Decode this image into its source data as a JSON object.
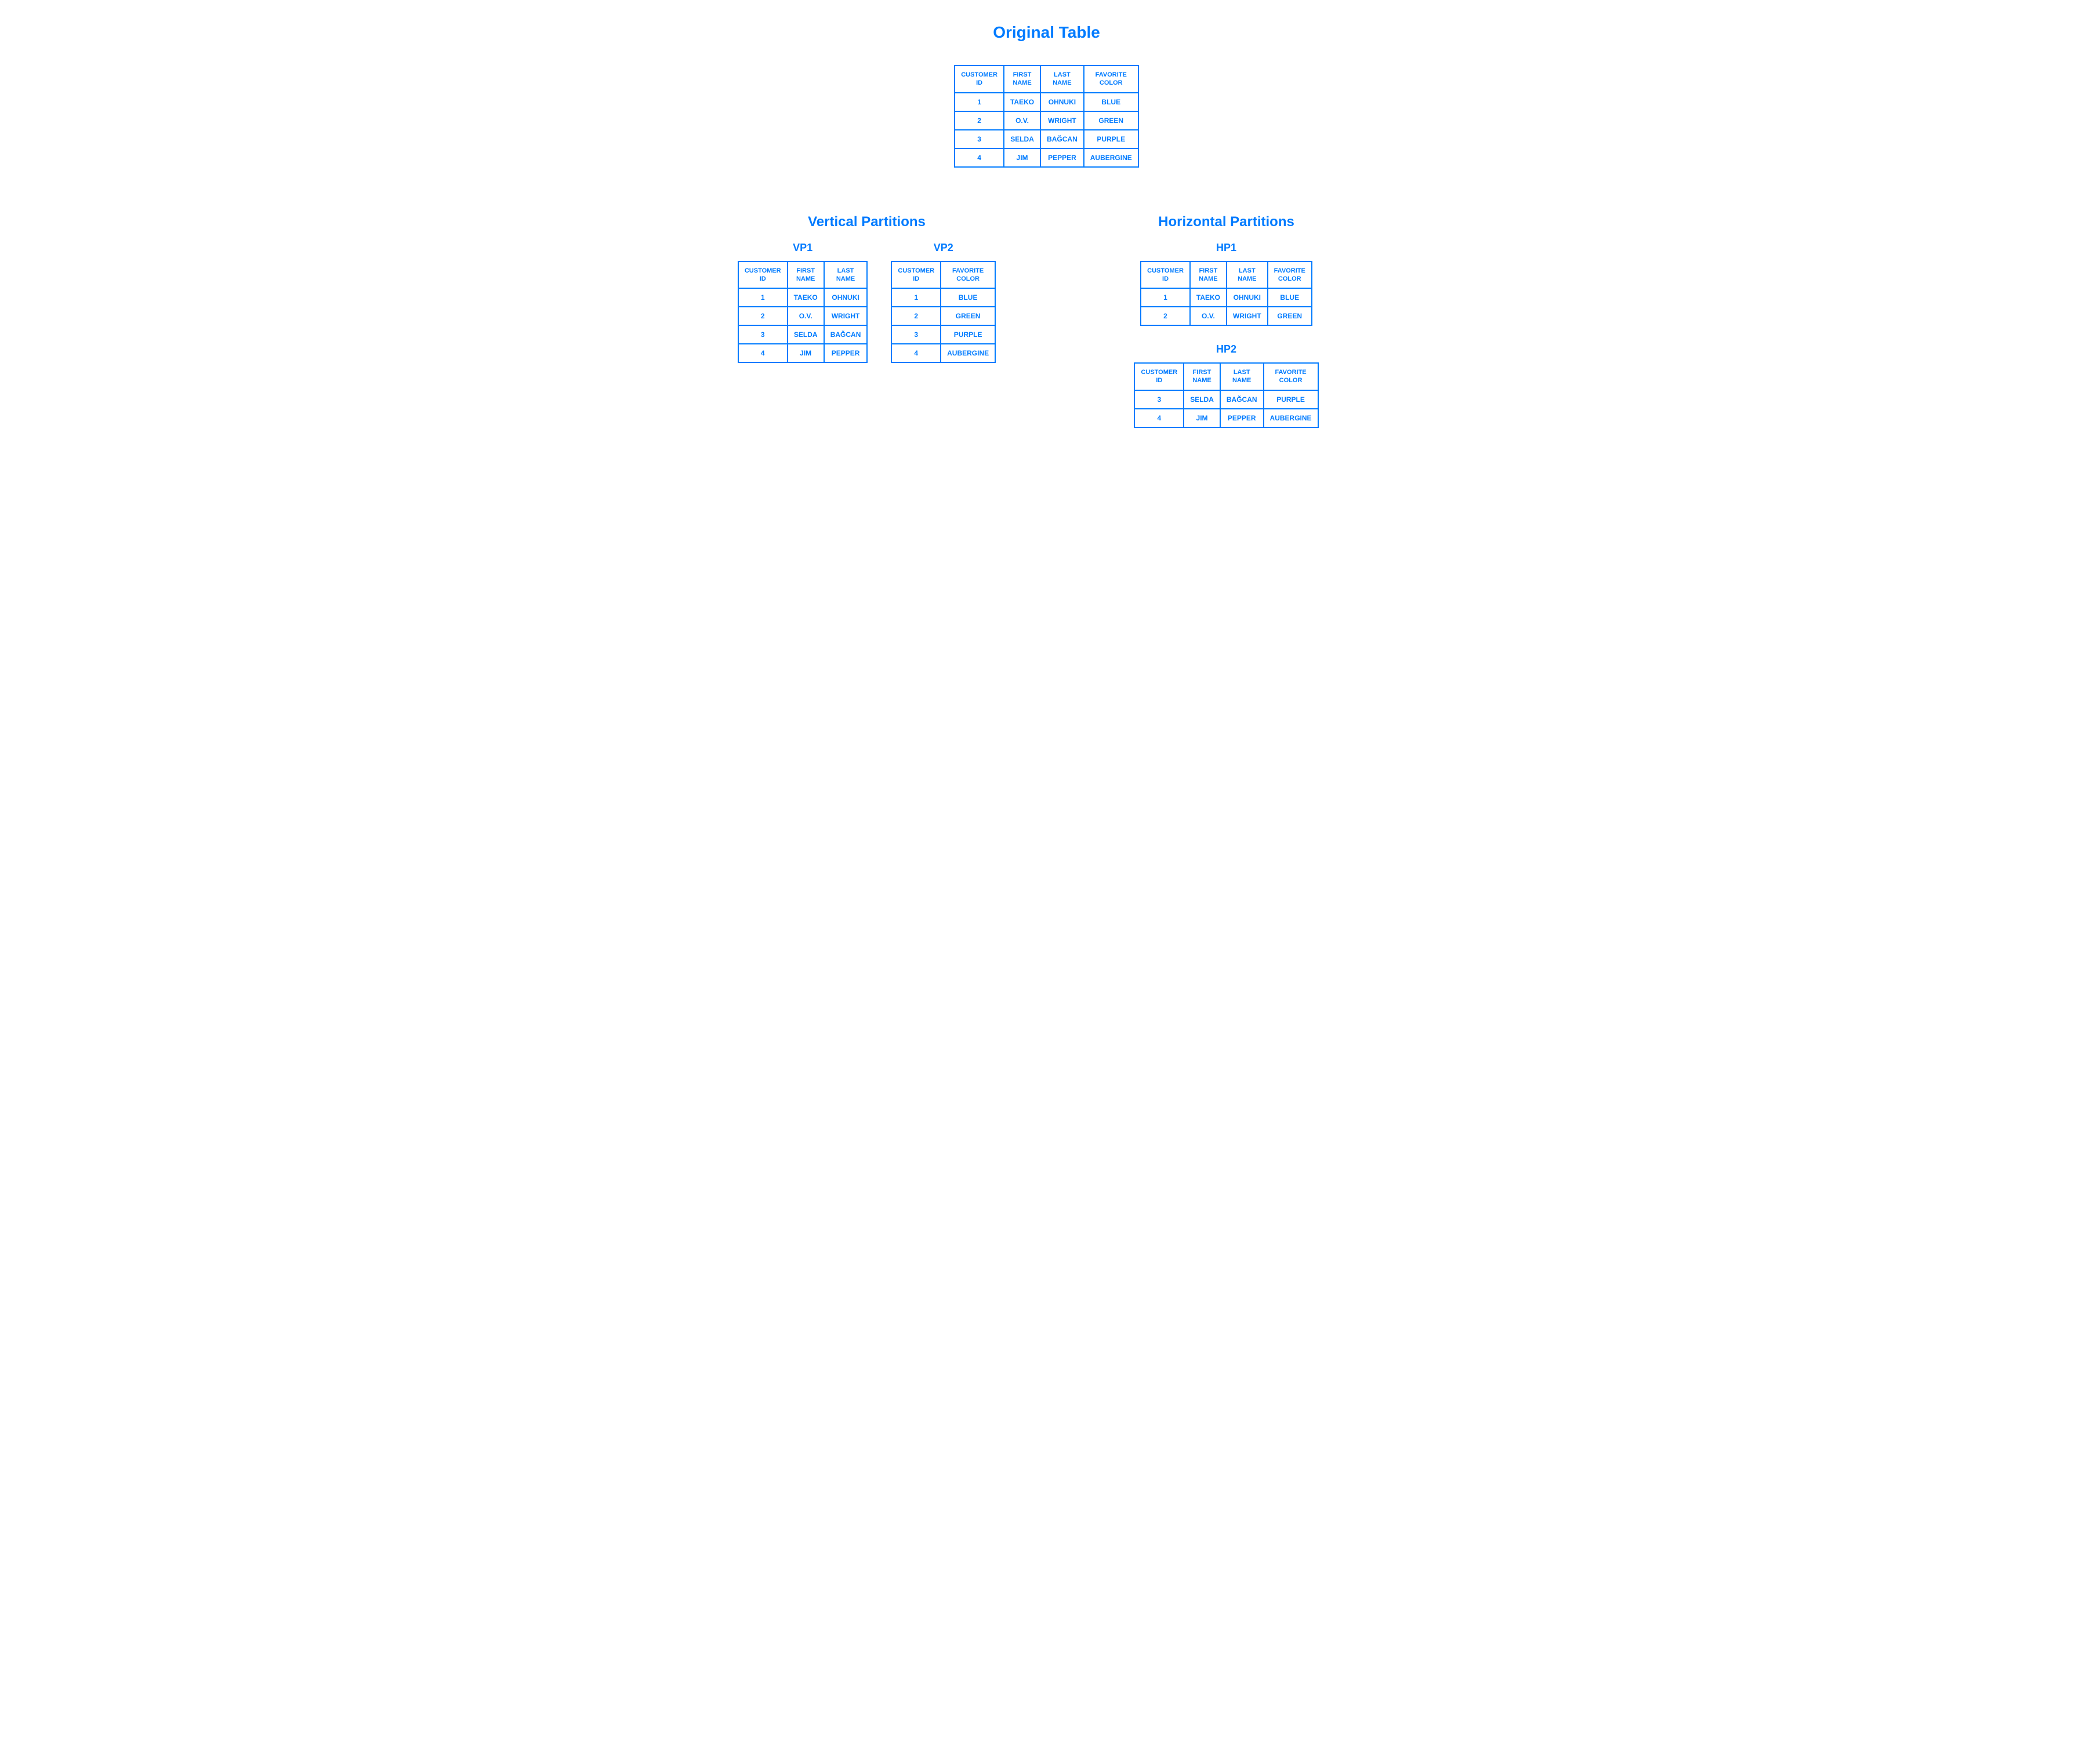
{
  "titles": {
    "original": "Original Table",
    "vertical": "Vertical Partitions",
    "horizontal": "Horizontal Partitions",
    "vp1": "VP1",
    "vp2": "VP2",
    "hp1": "HP1",
    "hp2": "HP2"
  },
  "headers": {
    "customer_id": "CUSTOMER ID",
    "first_name": "FIRST NAME",
    "last_name": "LAST NAME",
    "favorite_color": "FAVORITE COLOR"
  },
  "original_rows": [
    {
      "id": "1",
      "first": "TAEKO",
      "last": "OHNUKI",
      "color": "BLUE"
    },
    {
      "id": "2",
      "first": "O.V.",
      "last": "WRIGHT",
      "color": "GREEN"
    },
    {
      "id": "3",
      "first": "SELDA",
      "last": "BAĞCAN",
      "color": "PURPLE"
    },
    {
      "id": "4",
      "first": "JIM",
      "last": "PEPPER",
      "color": "AUBERGINE"
    }
  ],
  "vp1_rows": [
    {
      "id": "1",
      "first": "TAEKO",
      "last": "OHNUKI"
    },
    {
      "id": "2",
      "first": "O.V.",
      "last": "WRIGHT"
    },
    {
      "id": "3",
      "first": "SELDA",
      "last": "BAĞCAN"
    },
    {
      "id": "4",
      "first": "JIM",
      "last": "PEPPER"
    }
  ],
  "vp2_rows": [
    {
      "id": "1",
      "color": "BLUE"
    },
    {
      "id": "2",
      "color": "GREEN"
    },
    {
      "id": "3",
      "color": "PURPLE"
    },
    {
      "id": "4",
      "color": "AUBERGINE"
    }
  ],
  "hp1_rows": [
    {
      "id": "1",
      "first": "TAEKO",
      "last": "OHNUKI",
      "color": "BLUE"
    },
    {
      "id": "2",
      "first": "O.V.",
      "last": "WRIGHT",
      "color": "GREEN"
    }
  ],
  "hp2_rows": [
    {
      "id": "3",
      "first": "SELDA",
      "last": "BAĞCAN",
      "color": "PURPLE"
    },
    {
      "id": "4",
      "first": "JIM",
      "last": "PEPPER",
      "color": "AUBERGINE"
    }
  ]
}
